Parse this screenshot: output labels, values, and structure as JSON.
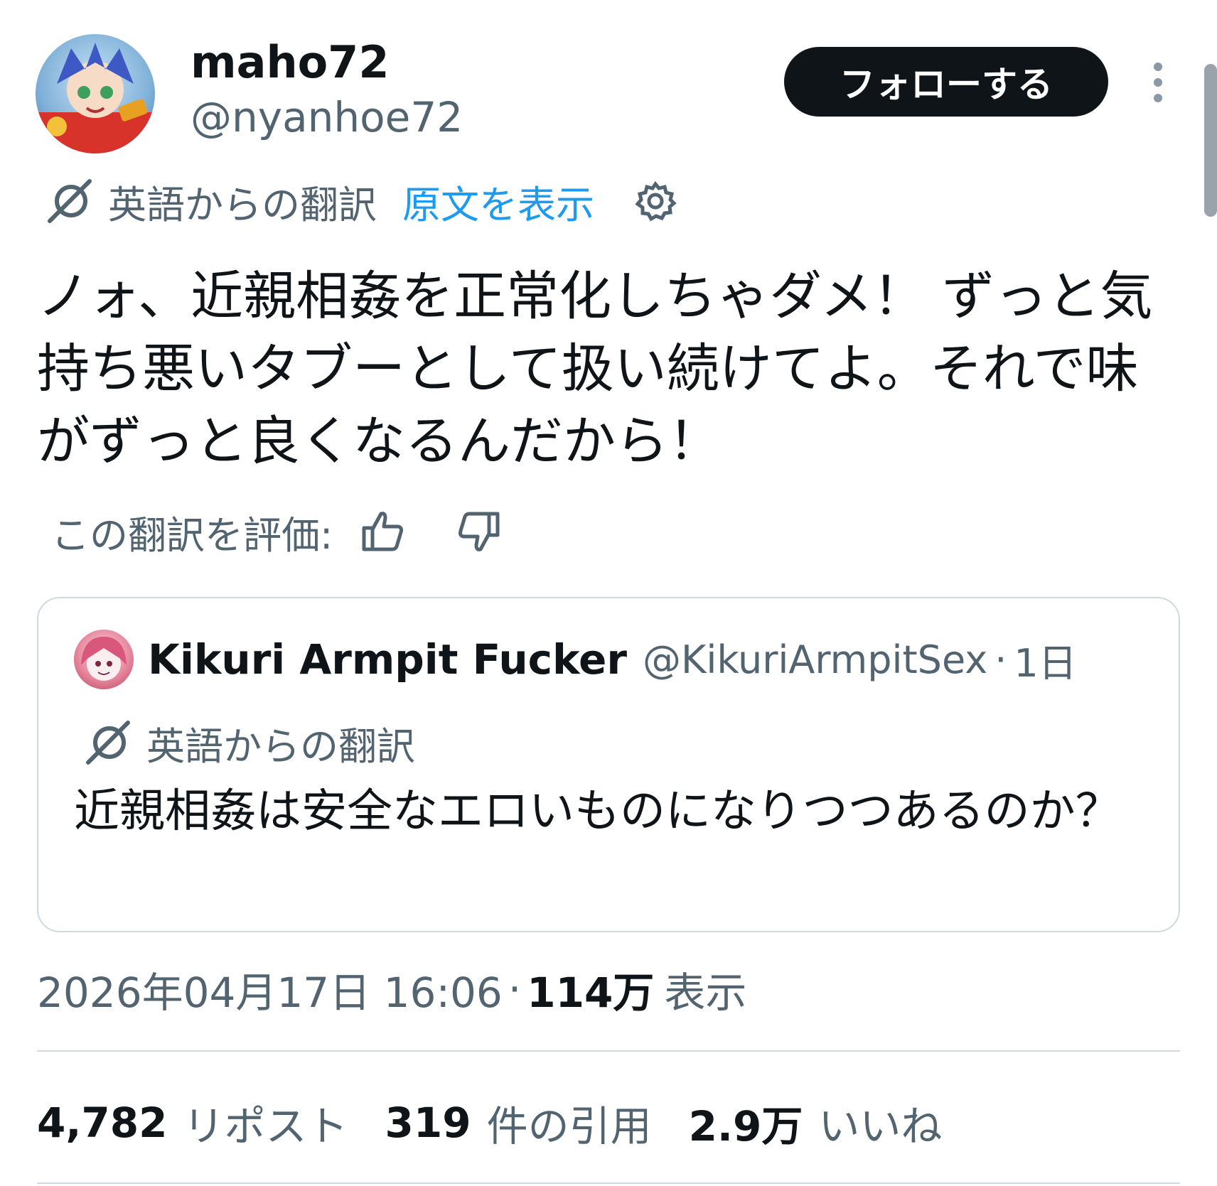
{
  "author": {
    "display_name": "maho72",
    "handle": "@nyanhoe72",
    "avatar_icon": "anime-character-avatar-icon"
  },
  "follow_button": {
    "label": "フォローする"
  },
  "more_icon": "vertical-ellipsis-icon",
  "translation_bar": {
    "icon": "translate-icon",
    "label": "英語からの翻訳",
    "show_original": "原文を表示",
    "settings_icon": "gear-icon"
  },
  "tweet": {
    "text": "ノォ、近親相姦を正常化しちゃダメ！ ずっと気持ち悪いタブーとして扱い続けてよ。それで味がずっと良くなるんだから！"
  },
  "rate_translation": {
    "label": "この翻訳を評価:",
    "thumbs_up_icon": "thumbs-up-icon",
    "thumbs_down_icon": "thumbs-down-icon"
  },
  "quoted_tweet": {
    "display_name": "Kikuri Armpit Fucker",
    "handle": "@KikuriArmpitSex",
    "separator": "·",
    "time": "1日",
    "avatar_icon": "anime-character-avatar-icon",
    "translation_label": "英語からの翻訳",
    "text": "近親相姦は安全なエロいものになりつつあるのか？"
  },
  "meta": {
    "datetime": "2026年04月17日 16:06",
    "separator": "·",
    "views_count": "114万",
    "views_label": "表示"
  },
  "stats": {
    "reposts_count": "4,782",
    "reposts_label": "リポスト",
    "quotes_count": "319",
    "quotes_label": "件の引用",
    "likes_count": "2.9万",
    "likes_label": "いいね"
  },
  "colors": {
    "text_primary": "#0f1419",
    "text_secondary": "#536471",
    "link": "#1d9bf0",
    "border": "#cfd9de",
    "button_bg": "#0f1419"
  }
}
